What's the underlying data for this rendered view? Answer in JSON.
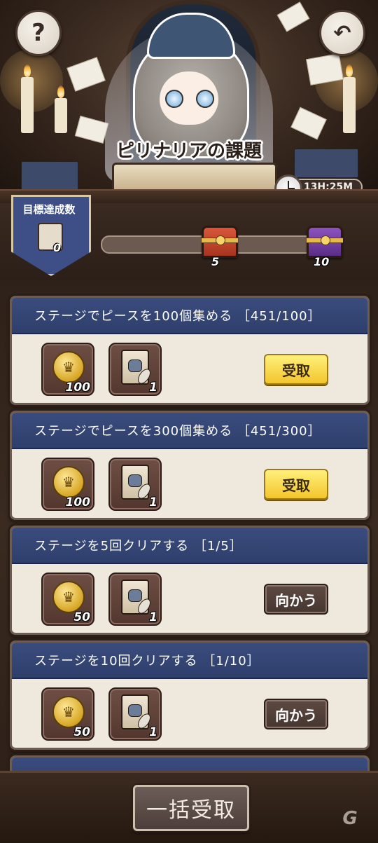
{
  "header": {
    "title": "ピリナリアの課題",
    "timer": "13H:25M",
    "help_icon": "question-mark-icon",
    "back_icon": "back-arrow-icon"
  },
  "progress": {
    "goal_label": "目標達成数",
    "goal_value": "0",
    "fraction": 0.0,
    "milestones": [
      {
        "value": "5",
        "chest": "red-treasure-chest-icon"
      },
      {
        "value": "10",
        "chest": "purple-treasure-chest-icon"
      }
    ]
  },
  "missions": [
    {
      "title": "ステージでピースを100個集める ［451/100］",
      "rewards": [
        {
          "icon": "gold-crown-coin-icon",
          "count": "100"
        },
        {
          "icon": "scroll-feather-icon",
          "count": "1"
        }
      ],
      "action": "受取",
      "state": "claimable"
    },
    {
      "title": "ステージでピースを300個集める ［451/300］",
      "rewards": [
        {
          "icon": "gold-crown-coin-icon",
          "count": "100"
        },
        {
          "icon": "scroll-feather-icon",
          "count": "1"
        }
      ],
      "action": "受取",
      "state": "claimable"
    },
    {
      "title": "ステージを5回クリアする ［1/5］",
      "rewards": [
        {
          "icon": "gold-crown-coin-icon",
          "count": "50"
        },
        {
          "icon": "scroll-feather-icon",
          "count": "1"
        }
      ],
      "action": "向かう",
      "state": "in-progress"
    },
    {
      "title": "ステージを10回クリアする ［1/10］",
      "rewards": [
        {
          "icon": "gold-crown-coin-icon",
          "count": "50"
        },
        {
          "icon": "scroll-feather-icon",
          "count": "1"
        }
      ],
      "action": "向かう",
      "state": "in-progress"
    }
  ],
  "footer": {
    "claim_all": "一括受取",
    "logo": "G"
  },
  "colors": {
    "header_blue": "#2f3f6c",
    "claim_yellow": "#f3c52d",
    "go_brown": "#463630",
    "card_bg": "#efe8dc"
  }
}
